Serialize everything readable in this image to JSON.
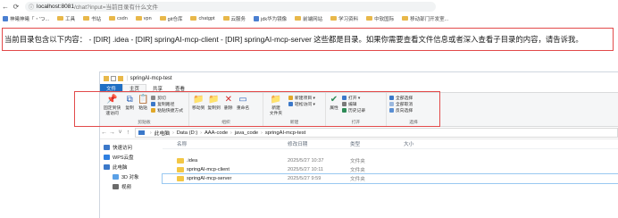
{
  "browser": {
    "url_host": "localhost:8081",
    "url_rest": "/chat?input=当前目录有什么文件",
    "bookmarks": [
      {
        "label": "神曦神曦「・'つ...",
        "type": "site"
      },
      {
        "label": "工具",
        "type": "folder"
      },
      {
        "label": "书站",
        "type": "folder"
      },
      {
        "label": "csdn",
        "type": "folder"
      },
      {
        "label": "vpn",
        "type": "folder"
      },
      {
        "label": "git仓库",
        "type": "folder"
      },
      {
        "label": "chatgpt",
        "type": "folder"
      },
      {
        "label": "云服务",
        "type": "folder"
      },
      {
        "label": "jdk华为镜像",
        "type": "site"
      },
      {
        "label": "前端网站",
        "type": "folder"
      },
      {
        "label": "学习资料",
        "type": "folder"
      },
      {
        "label": "中软国际",
        "type": "folder"
      },
      {
        "label": "移动部门开发室...",
        "type": "folder"
      }
    ]
  },
  "answer_text": "当前目录包含以下内容： - [DIR] .idea - [DIR] springAI-mcp-client - [DIR] springAI-mcp-server 这些都是目录。如果你需要查看文件信息或者深入查看子目录的内容，请告诉我。",
  "explorer": {
    "title": "springAI-mcp-test",
    "tabs": [
      "文件",
      "主页",
      "共享",
      "查看"
    ],
    "ribbon": {
      "clipboard": {
        "title": "剪贴板",
        "pin": "固定到快速访问",
        "copy": "复制",
        "paste": "粘贴",
        "cut": "剪切",
        "copy_path": "复制路径",
        "paste_shortcut": "粘贴快捷方式"
      },
      "organize": {
        "title": "组织",
        "move_to": "移动到",
        "copy_to": "复制到",
        "delete": "删除",
        "rename": "重命名"
      },
      "new": {
        "title": "新建",
        "new_folder": "新建\n文件夹",
        "new_item": "新建项目 ▾",
        "easy_access": "轻松访问 ▾"
      },
      "open": {
        "title": "打开",
        "properties": "属性",
        "open": "打开 ▾",
        "edit": "编辑",
        "history": "历史记录"
      },
      "select": {
        "title": "选择",
        "select_all": "全部选择",
        "select_none": "全部取消",
        "invert": "反向选择"
      }
    },
    "breadcrumbs": [
      "此电脑",
      "Data (D:)",
      "AAA-code",
      "java_code",
      "springAI-mcp-test"
    ],
    "sidebar": [
      {
        "label": "快速访问",
        "indent": false,
        "color": "#3b78c9"
      },
      {
        "label": "WPS云盘",
        "indent": false,
        "color": "#2f7fe0"
      },
      {
        "label": "此电脑",
        "indent": false,
        "color": "#3b78c9"
      },
      {
        "label": "3D 对象",
        "indent": true,
        "color": "#5aa0e6"
      },
      {
        "label": "视频",
        "indent": true,
        "color": "#6b6b6b"
      }
    ],
    "columns": [
      "名称",
      "修改日期",
      "类型",
      "大小"
    ],
    "files": [
      {
        "name": ".idea",
        "date": "2025/5/27 10:37",
        "type": "文件夹",
        "size": ""
      },
      {
        "name": "springAI-mcp-client",
        "date": "2025/5/27 10:11",
        "type": "文件夹",
        "size": ""
      },
      {
        "name": "springAI-mcp-server",
        "date": "2025/5/27 9:59",
        "type": "文件夹",
        "size": ""
      }
    ]
  }
}
